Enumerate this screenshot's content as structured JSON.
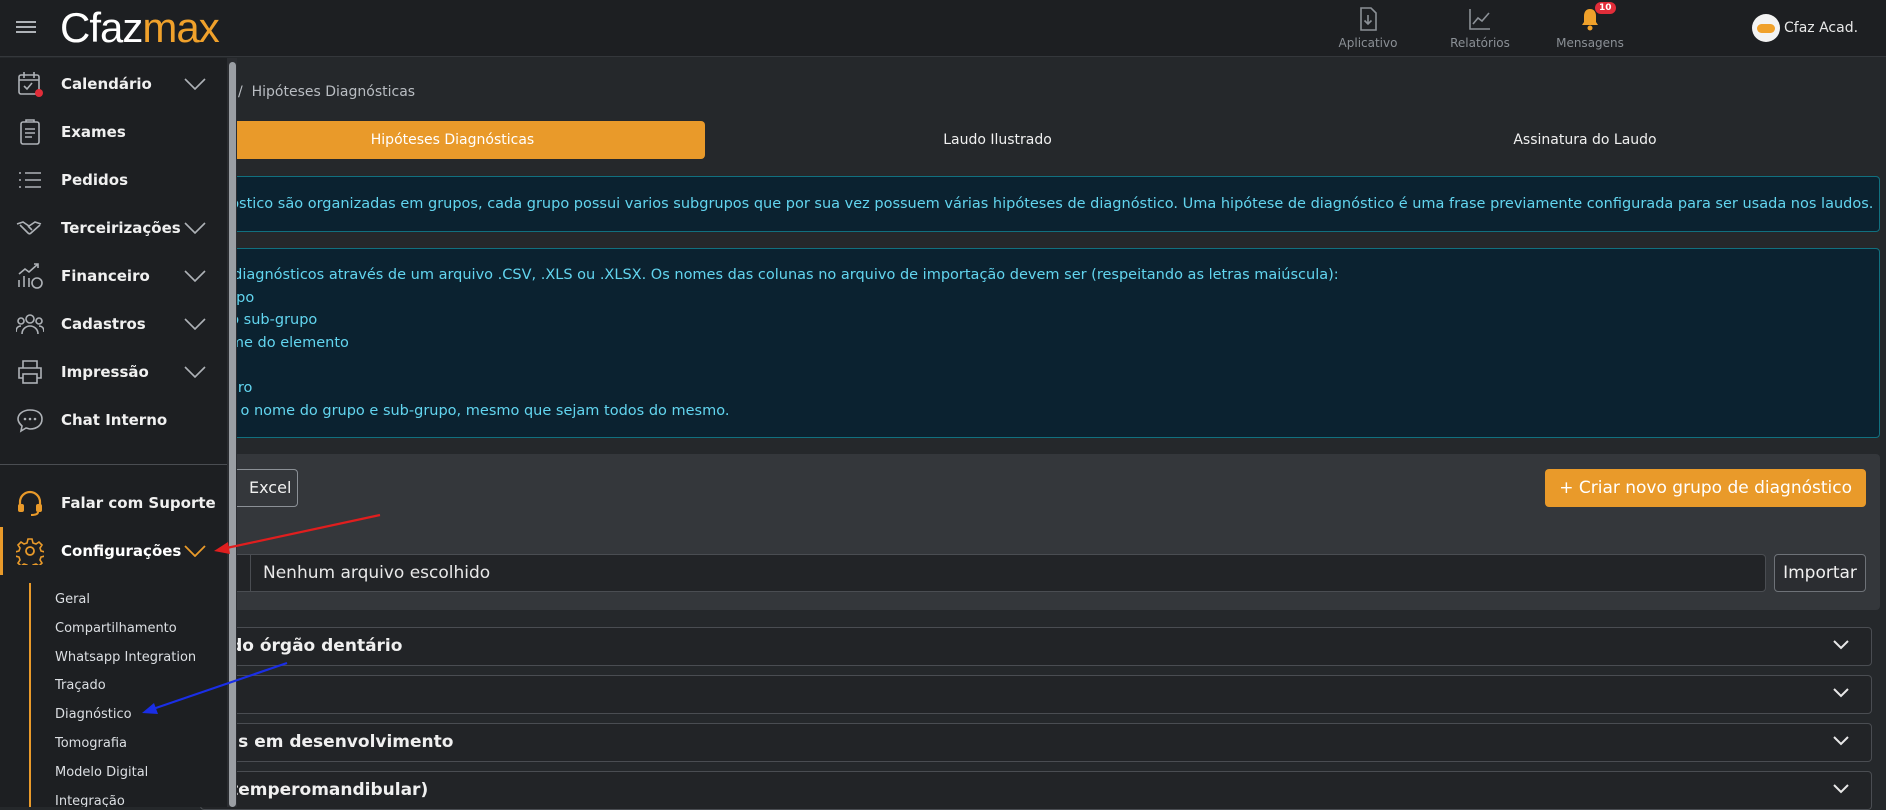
{
  "header": {
    "logo_part1": "Cfaz",
    "logo_part2": "max",
    "items": [
      {
        "label": "Aplicativo",
        "icon": "download-doc-icon"
      },
      {
        "label": "Relatórios",
        "icon": "chart-icon"
      },
      {
        "label": "Mensagens",
        "icon": "bell-icon",
        "badge": "10"
      }
    ],
    "user_name": "Cfaz Acad."
  },
  "sidebar": {
    "items": [
      {
        "label": "Calendário",
        "icon": "calendar-icon"
      },
      {
        "label": "Exames",
        "icon": "clipboard-icon"
      },
      {
        "label": "Pedidos",
        "icon": "list-icon"
      },
      {
        "label": "Terceirizações",
        "icon": "handshake-icon"
      },
      {
        "label": "Financeiro",
        "icon": "finance-icon"
      },
      {
        "label": "Cadastros",
        "icon": "users-icon"
      },
      {
        "label": "Impressão",
        "icon": "printer-icon"
      },
      {
        "label": "Chat Interno",
        "icon": "chat-icon"
      }
    ],
    "support": {
      "label": "Falar com Suporte",
      "icon": "headset-icon"
    },
    "settings": {
      "label": "Configurações",
      "icon": "gear-icon"
    },
    "sub_items": [
      "Geral",
      "Compartilhamento",
      "Whatsapp Integration",
      "Traçado",
      "Diagnóstico",
      "Tomografia",
      "Modelo Digital",
      "Integração"
    ]
  },
  "breadcrumb": {
    "separator": "/",
    "current": "Hipóteses Diagnósticas"
  },
  "tabs": [
    "Hipóteses Diagnósticas",
    "Laudo Ilustrado",
    "Assinatura do Laudo"
  ],
  "info": {
    "line1": "nóstico são organizadas em grupos, cada grupo possui varios subgrupos que por sua vez possuem várias hipóteses de diagnóstico. Uma hipótese de diagnóstico é uma frase previamente configurada para ser usada nos laudos.",
    "lines2": [
      "s diagnósticos através de um arquivo .CSV, .XLS ou .XLSX. Os nomes das colunas no arquivo de importação devem ser (respeitando as letras maiúscula):",
      "rupo",
      "do sub-grupo",
      "ome do elemento",
      "",
      "acro",
      "er o nome do grupo e sub-grupo, mesmo que sejam todos do mesmo."
    ]
  },
  "toolbar": {
    "excel_label": "Excel",
    "new_group_label": "+ Criar novo grupo de diagnóstico",
    "file_placeholder": "Nenhum arquivo escolhido",
    "import_label": "Importar"
  },
  "groups": [
    "ão do órgão dentário",
    "",
    "árias em desenvolvimento",
    "ão temperomandibular)"
  ],
  "colors": {
    "accent": "#e99a2a",
    "info_text": "#62d5ef",
    "annotation_red": "#e01e1e",
    "annotation_blue": "#1a2ee6"
  }
}
